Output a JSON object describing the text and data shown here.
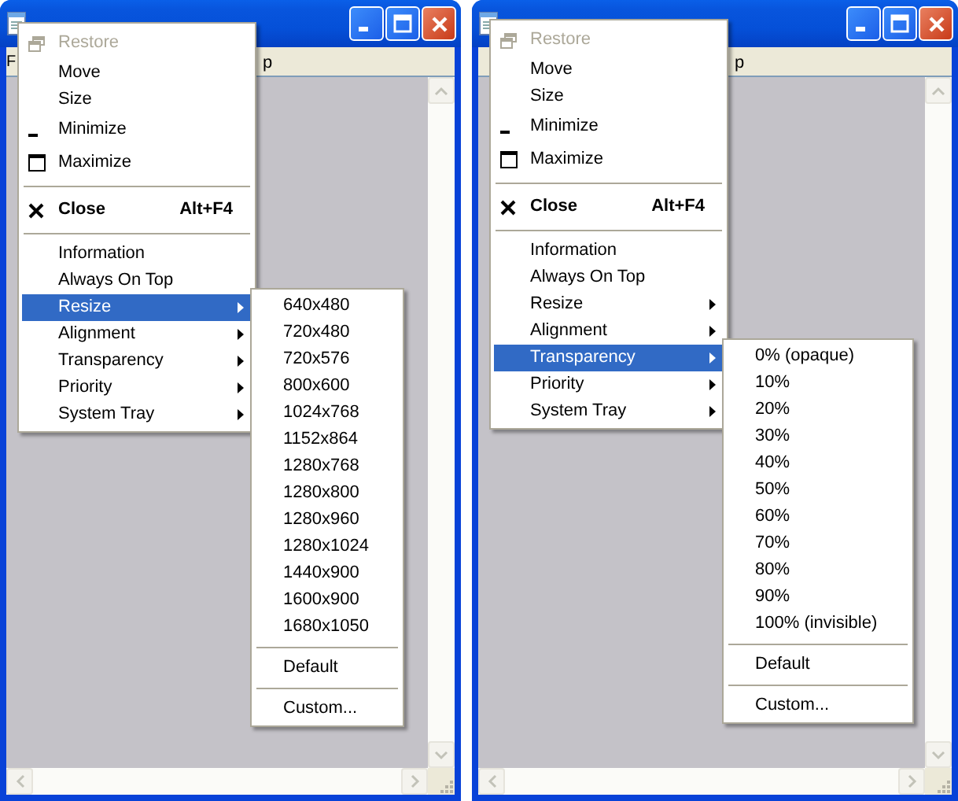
{
  "windows": [
    {
      "menu_bar": {
        "left_fragment": "F",
        "right_fragment": "p"
      },
      "system_menu": [
        {
          "kind": "restore",
          "label": "Restore",
          "disabled": true,
          "selected": false,
          "default": false
        },
        {
          "kind": "command",
          "label": "Move",
          "disabled": false,
          "selected": false,
          "default": false
        },
        {
          "kind": "command",
          "label": "Size",
          "disabled": false,
          "selected": false,
          "default": false
        },
        {
          "kind": "minimize",
          "label": "Minimize",
          "disabled": false,
          "selected": false,
          "default": false
        },
        {
          "kind": "maximize",
          "label": "Maximize",
          "disabled": false,
          "selected": false,
          "default": false
        },
        {
          "kind": "separator"
        },
        {
          "kind": "close",
          "label": "Close",
          "shortcut": "Alt+F4",
          "disabled": false,
          "selected": false,
          "default": true
        },
        {
          "kind": "separator"
        },
        {
          "kind": "command",
          "label": "Information",
          "disabled": false,
          "selected": false,
          "default": false
        },
        {
          "kind": "command",
          "label": "Always On Top",
          "disabled": false,
          "selected": false,
          "default": false
        },
        {
          "kind": "submenu",
          "label": "Resize",
          "disabled": false,
          "selected": true,
          "default": false
        },
        {
          "kind": "submenu",
          "label": "Alignment",
          "disabled": false,
          "selected": false,
          "default": false
        },
        {
          "kind": "submenu",
          "label": "Transparency",
          "disabled": false,
          "selected": false,
          "default": false
        },
        {
          "kind": "submenu",
          "label": "Priority",
          "disabled": false,
          "selected": false,
          "default": false
        },
        {
          "kind": "submenu",
          "label": "System Tray",
          "disabled": false,
          "selected": false,
          "default": false
        }
      ],
      "submenu": [
        {
          "kind": "command",
          "label": "640x480"
        },
        {
          "kind": "command",
          "label": "720x480"
        },
        {
          "kind": "command",
          "label": "720x576"
        },
        {
          "kind": "command",
          "label": "800x600"
        },
        {
          "kind": "command",
          "label": "1024x768"
        },
        {
          "kind": "command",
          "label": "1152x864"
        },
        {
          "kind": "command",
          "label": "1280x768"
        },
        {
          "kind": "command",
          "label": "1280x800"
        },
        {
          "kind": "command",
          "label": "1280x960"
        },
        {
          "kind": "command",
          "label": "1280x1024"
        },
        {
          "kind": "command",
          "label": "1440x900"
        },
        {
          "kind": "command",
          "label": "1600x900"
        },
        {
          "kind": "command",
          "label": "1680x1050"
        },
        {
          "kind": "separator"
        },
        {
          "kind": "command",
          "label": "Default"
        },
        {
          "kind": "separator"
        },
        {
          "kind": "command",
          "label": "Custom..."
        }
      ]
    },
    {
      "menu_bar": {
        "right_fragment": "p"
      },
      "system_menu": [
        {
          "kind": "restore",
          "label": "Restore",
          "disabled": true,
          "selected": false,
          "default": false
        },
        {
          "kind": "command",
          "label": "Move",
          "disabled": false,
          "selected": false,
          "default": false
        },
        {
          "kind": "command",
          "label": "Size",
          "disabled": false,
          "selected": false,
          "default": false
        },
        {
          "kind": "minimize",
          "label": "Minimize",
          "disabled": false,
          "selected": false,
          "default": false
        },
        {
          "kind": "maximize",
          "label": "Maximize",
          "disabled": false,
          "selected": false,
          "default": false
        },
        {
          "kind": "separator"
        },
        {
          "kind": "close",
          "label": "Close",
          "shortcut": "Alt+F4",
          "disabled": false,
          "selected": false,
          "default": true
        },
        {
          "kind": "separator"
        },
        {
          "kind": "command",
          "label": "Information",
          "disabled": false,
          "selected": false,
          "default": false
        },
        {
          "kind": "command",
          "label": "Always On Top",
          "disabled": false,
          "selected": false,
          "default": false
        },
        {
          "kind": "submenu",
          "label": "Resize",
          "disabled": false,
          "selected": false,
          "default": false
        },
        {
          "kind": "submenu",
          "label": "Alignment",
          "disabled": false,
          "selected": false,
          "default": false
        },
        {
          "kind": "submenu",
          "label": "Transparency",
          "disabled": false,
          "selected": true,
          "default": false
        },
        {
          "kind": "submenu",
          "label": "Priority",
          "disabled": false,
          "selected": false,
          "default": false
        },
        {
          "kind": "submenu",
          "label": "System Tray",
          "disabled": false,
          "selected": false,
          "default": false
        }
      ],
      "submenu": [
        {
          "kind": "command",
          "label": "0% (opaque)"
        },
        {
          "kind": "command",
          "label": "10%"
        },
        {
          "kind": "command",
          "label": "20%"
        },
        {
          "kind": "command",
          "label": "30%"
        },
        {
          "kind": "command",
          "label": "40%"
        },
        {
          "kind": "command",
          "label": "50%"
        },
        {
          "kind": "command",
          "label": "60%"
        },
        {
          "kind": "command",
          "label": "70%"
        },
        {
          "kind": "command",
          "label": "80%"
        },
        {
          "kind": "command",
          "label": "90%"
        },
        {
          "kind": "command",
          "label": "100% (invisible)"
        },
        {
          "kind": "separator"
        },
        {
          "kind": "command",
          "label": "Default"
        },
        {
          "kind": "separator"
        },
        {
          "kind": "command",
          "label": "Custom..."
        }
      ]
    }
  ]
}
